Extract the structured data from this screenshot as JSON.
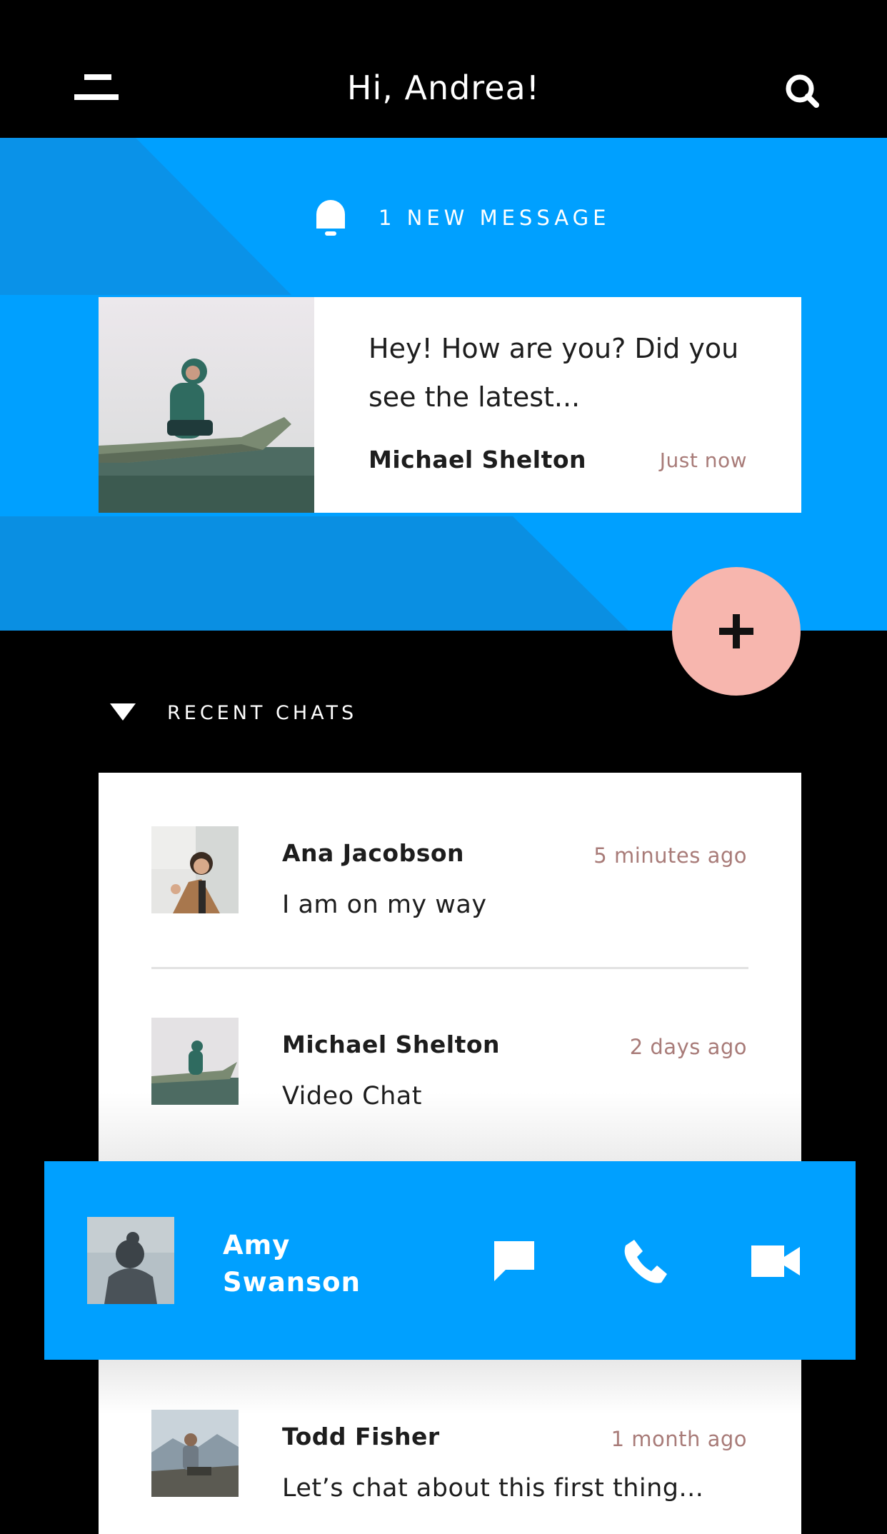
{
  "header": {
    "title": "Hi, Andrea!",
    "menu_icon": "menu-icon",
    "search_icon": "search-icon"
  },
  "notification": {
    "icon": "bell-icon",
    "text": "1 NEW MESSAGE"
  },
  "new_message": {
    "text": "Hey! How are you? Did you see the latest...",
    "sender": "Michael Shelton",
    "time": "Just now"
  },
  "fab": {
    "icon": "plus-icon"
  },
  "recent_chats": {
    "label": "RECENT CHATS",
    "items": [
      {
        "name": "Ana Jacobson",
        "preview": "I am on my way",
        "time": "5 minutes ago"
      },
      {
        "name": "Michael Shelton",
        "preview": "Video Chat",
        "time": "2 days ago"
      },
      {
        "name": "Todd Fisher",
        "preview": "Let’s chat about this first thing...",
        "time": "1 month ago"
      }
    ]
  },
  "active_contact": {
    "first_name": "Amy",
    "last_name": "Swanson",
    "actions": [
      "message-icon",
      "phone-icon",
      "video-icon"
    ]
  },
  "colors": {
    "background": "#000000",
    "accent_blue": "#00a0ff",
    "fab_pink": "#f7b6ae",
    "timestamp": "#a87b78"
  }
}
